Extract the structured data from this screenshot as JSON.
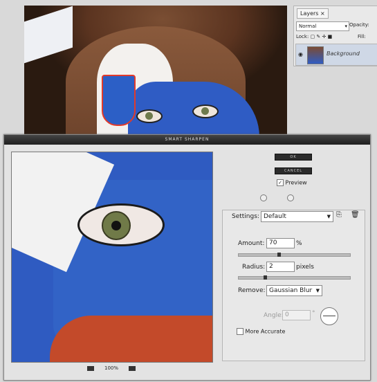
{
  "layers_panel": {
    "tab_label": "Layers",
    "close_glyph": "×",
    "blend_mode": "Normal",
    "opacity_label": "Opacity:",
    "lock_label": "Lock:",
    "fill_label": "Fill:",
    "layer_name": "Background"
  },
  "dialog": {
    "title": "SMART SHARPEN",
    "ok_label": "OK",
    "cancel_label": "CANCEL",
    "preview_label": "Preview",
    "preview_checked": true,
    "zoom_value": "100%",
    "settings_label": "Settings:",
    "settings_value": "Default",
    "amount_label": "Amount:",
    "amount_value": "70",
    "amount_unit": "%",
    "radius_label": "Radius:",
    "radius_value": "2",
    "radius_unit": "pixels",
    "remove_label": "Remove:",
    "remove_value": "Gaussian Blur",
    "angle_label": "Angle:",
    "angle_value": "0",
    "angle_unit": "°",
    "more_accurate_label": "More Accurate",
    "more_accurate_checked": false
  },
  "icons": [
    "eye-icon",
    "save-settings-icon",
    "delete-settings-icon",
    "dropdown-arrow-icon",
    "zoom-out-icon",
    "zoom-in-icon"
  ],
  "colors": {
    "dialog_titlebar": "#1e1e1e",
    "layer_selected": "#cfd8e6"
  }
}
